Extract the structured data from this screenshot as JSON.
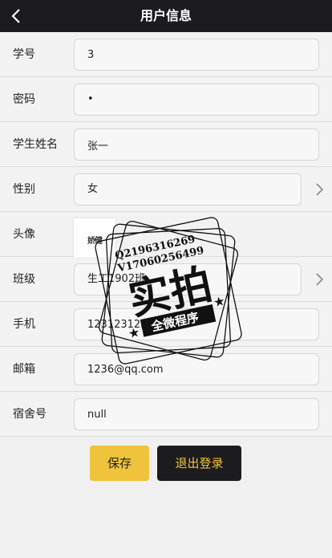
{
  "header": {
    "title": "用户信息",
    "back_icon": "chevron-left-icon"
  },
  "fields": {
    "student_id": {
      "label": "学号",
      "value": "3"
    },
    "password": {
      "label": "密码",
      "value": "•"
    },
    "name": {
      "label": "学生姓名",
      "value": "张一"
    },
    "gender": {
      "label": "性别",
      "value": "女"
    },
    "avatar": {
      "label": "头像",
      "image_text": "娇健"
    },
    "class": {
      "label": "班级",
      "value": "生工1902班"
    },
    "phone": {
      "label": "手机",
      "value": "12312312312"
    },
    "email": {
      "label": "邮箱",
      "value": "1236@qq.com"
    },
    "dorm": {
      "label": "宿舍号",
      "value": "null"
    }
  },
  "buttons": {
    "save": "保存",
    "logout": "退出登录"
  },
  "watermark": {
    "line1": "Q2196316269",
    "line2": "V17060256499",
    "big": "实拍",
    "banner": "全微程序"
  },
  "colors": {
    "header_bg": "#1c1c1e",
    "accent": "#f0c33c",
    "page_bg": "#f0f0f0"
  }
}
